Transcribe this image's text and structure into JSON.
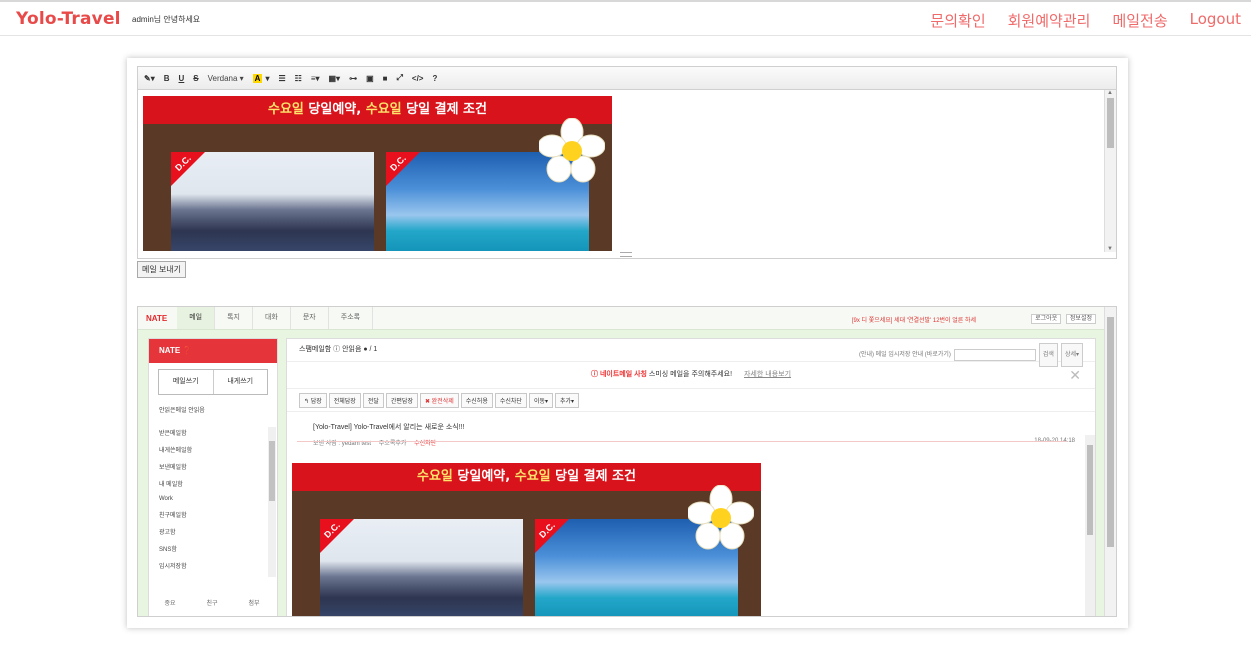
{
  "brand": "Yolo-Travel",
  "greeting": "admin님 안녕하세요",
  "nav": [
    "문의확인",
    "회원예약관리",
    "메일전송",
    "Logout"
  ],
  "editor": {
    "toolbar": {
      "pen": "✎▾",
      "bold": "B",
      "underline": "U",
      "strike": "S",
      "font": "Verdana ▾",
      "color": "A",
      "color_dropdown": "▾",
      "list_ul": "☰",
      "list_ol": "☷",
      "align": "≡▾",
      "table": "▦▾",
      "link": "⊶",
      "image": "▣",
      "video": "■",
      "fullscreen": "⤢",
      "code": "</>",
      "help": "?"
    },
    "send_label": "메일 보내기"
  },
  "banner": {
    "title_part1": "수요일",
    "title_part2": " 당일예약, ",
    "title_part3": "수요일",
    "title_part4": " 당일 결제 조건",
    "badge": "D.C."
  },
  "webmail": {
    "logo": "NATE",
    "tabs": [
      "메일",
      "톡지",
      "대화",
      "문자",
      "주소록"
    ],
    "promo": "[9x 디 쫓으세요] 세대 '연결선발' 12번이 얼른 하세",
    "login": "로그아웃",
    "setting": "정보설정",
    "side": {
      "head": "NATE ❓",
      "write": "메일쓰기",
      "to_me": "내게쓰기",
      "unread": "안읽은메일  안읽음",
      "folders": [
        "받은메일함",
        "내게쓴메일함",
        "보낸메일함",
        "내 메일함",
        "Work",
        "친구메일함",
        "광고함",
        "SNS함",
        "임시저장함"
      ],
      "foot": [
        "중요",
        "친구",
        "첨부"
      ]
    },
    "content": {
      "folder": "스팸메일함 ⓘ 안읽음 ● / 1",
      "search_hint": "(안내) 메일 임시저장 안내 (바로가기)",
      "search_btn": "검색",
      "detail_btn": "상세▾",
      "warn_red": "네이트메일 사칭",
      "warn_text": " 스미싱 메일을 주의해주세요!",
      "warn_link": "자세한 내용보기",
      "actions": [
        "↰ 답장",
        "전체답장",
        "전달",
        "간편답장",
        "✖ 완전삭제",
        "수신허용",
        "수신차단",
        "이동▾",
        "추가▾"
      ],
      "subject": "[Yolo-Travel] Yolo-Travel에서 알리는 새로운 소식!!!",
      "from_label": "보낸 사람 : ",
      "from_addr": "yedam test",
      "from_add": "주소록추가",
      "from_block": "수신차단",
      "date": "18-09-20 14:18"
    }
  }
}
